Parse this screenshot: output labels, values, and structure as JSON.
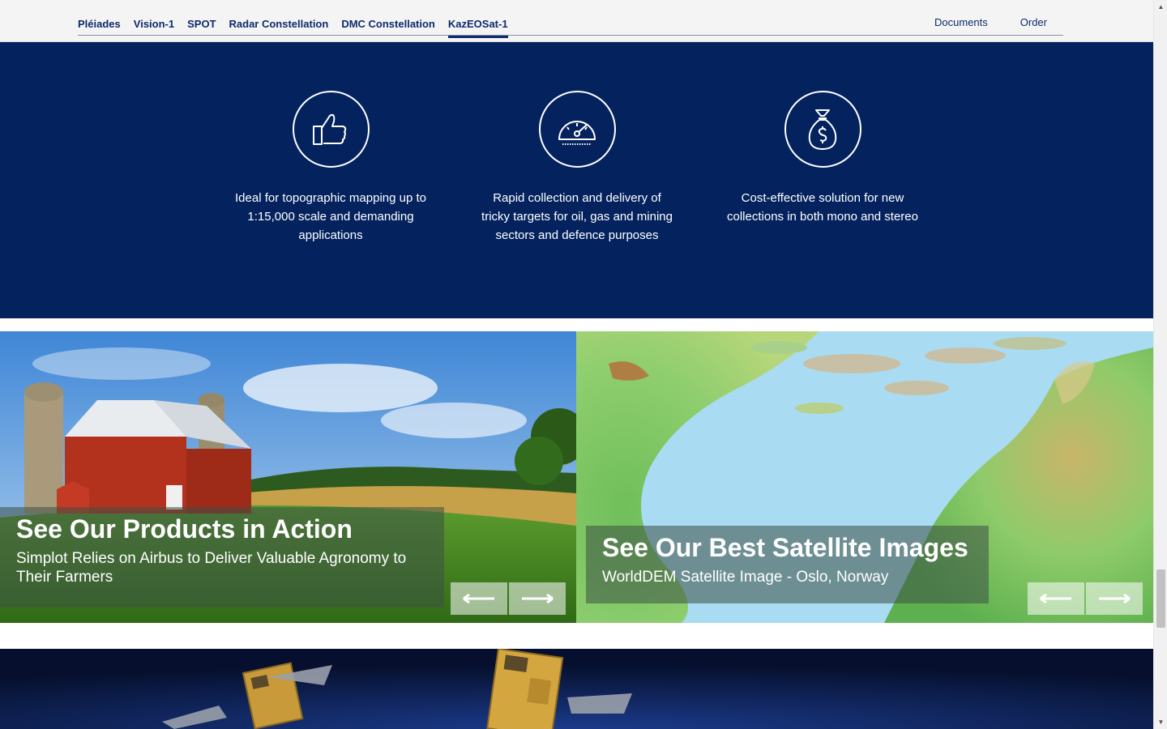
{
  "nav": {
    "tabs": [
      {
        "label": "Pléiades"
      },
      {
        "label": "Vision-1"
      },
      {
        "label": "SPOT"
      },
      {
        "label": "Radar Constellation"
      },
      {
        "label": "DMC Constellation"
      },
      {
        "label": "KazEOSat-1"
      }
    ],
    "active_tab": "KazEOSat-1",
    "links": [
      {
        "label": "Documents"
      },
      {
        "label": "Order"
      }
    ]
  },
  "features": [
    {
      "icon": "thumbs-up-icon",
      "text": "Ideal for topographic mapping up to 1:15,000 scale and demanding applications"
    },
    {
      "icon": "speedometer-icon",
      "text": "Rapid collection and delivery of tricky targets for oil, gas and mining sectors and defence purposes"
    },
    {
      "icon": "money-bag-icon",
      "text": "Cost-effective solution for new collections in both mono and stereo"
    }
  ],
  "cards": [
    {
      "title": "See Our Products in Action",
      "subtitle": "Simplot Relies on Airbus to Deliver Valuable Agronomy to Their Farmers",
      "image": "farm-barn-cornfield"
    },
    {
      "title": "See Our Best Satellite Images",
      "subtitle": "WorldDEM Satellite Image - Oslo, Norway",
      "image": "terrain-elevation-map"
    }
  ],
  "colors": {
    "brand_blue": "#04235e",
    "nav_text": "#0d2a6b",
    "nav_bg": "#f4f4f5"
  }
}
